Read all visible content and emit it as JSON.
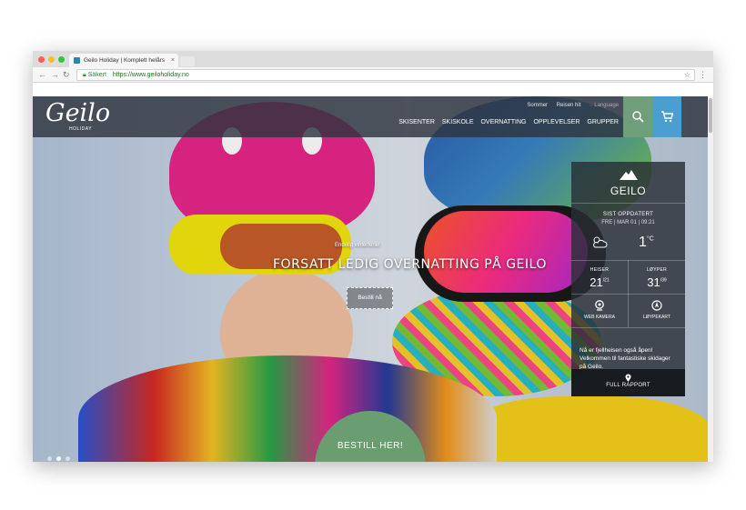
{
  "browser": {
    "tab_title": "Geilo Holiday | Komplett helårs",
    "tab_close": "×",
    "secure_label": "Säkert",
    "url": "https://www.geiloholiday.no"
  },
  "site": {
    "logo": "Geilo",
    "logo_sub": "HOLIDAY",
    "top_links": [
      "Sommer",
      "Reisen hit",
      "Language"
    ],
    "nav": [
      "SKISENTER",
      "SKISKOLE",
      "OVERNATTING",
      "OPPLEVELSER",
      "GRUPPER"
    ]
  },
  "hero": {
    "pretitle": "Endelig vinterferie!",
    "title": "FORSATT LEDIG OVERNATTING PÅ GEILO",
    "button": "Bestill nå",
    "cta": "BESTILL HER!"
  },
  "weather": {
    "location": "GEILO",
    "updated_label": "SIST OPPDATERT",
    "date": "FRE | MAR 01 | 09:21",
    "temp": "1",
    "temp_unit": "°C",
    "lifts_label": "HEISER",
    "lifts_open": "21",
    "lifts_total": "/21",
    "slopes_label": "LØYPER",
    "slopes_open": "31",
    "slopes_total": "/39",
    "webcam_label": "WEB KAMERA",
    "map_label": "LØYPEKART",
    "message": "Nå er fjellheisen også åpen! Velkommen til fantastiske skidager på Geilo.",
    "report_label": "FULL RAPPORT"
  },
  "slider": {
    "count": 3,
    "active": 1
  },
  "colors": {
    "search_btn": "#6e9e7a",
    "cart_btn": "#4a9ed0",
    "cta": "#6a9d70",
    "header": "#2e343e"
  }
}
